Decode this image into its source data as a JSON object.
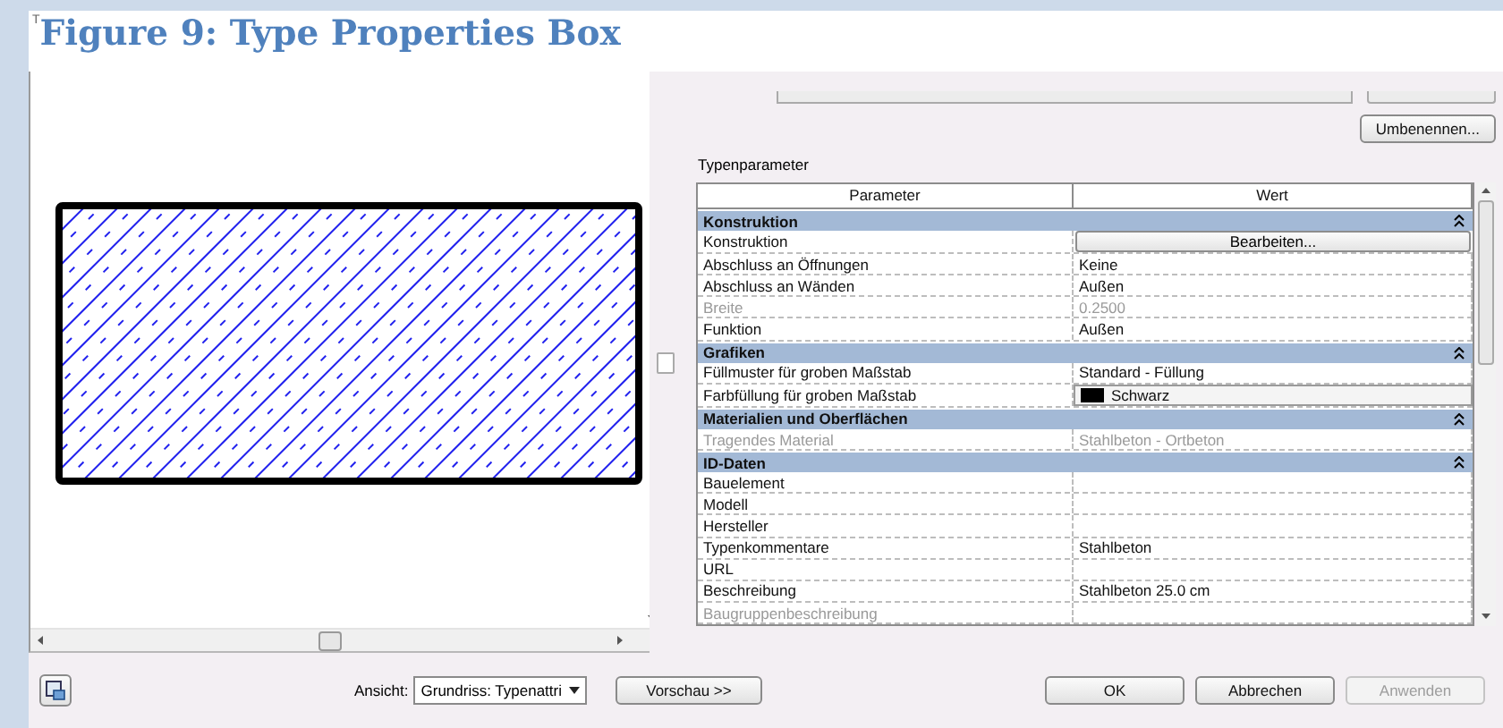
{
  "dialog_title_fragment": "T",
  "title": "Figure 9: Type Properties Box",
  "rename_button": "Umbenennen...",
  "section_label": "Typenparameter",
  "columns": [
    "Parameter",
    "Wert"
  ],
  "groups": [
    {
      "name": "Konstruktion",
      "expanded": true,
      "rows": [
        {
          "parameter": "Konstruktion",
          "value": "Bearbeiten...",
          "kind": "button",
          "disabled": false
        },
        {
          "parameter": "Abschluss an Öffnungen",
          "value": "Keine",
          "kind": "text",
          "disabled": false
        },
        {
          "parameter": "Abschluss an Wänden",
          "value": "Außen",
          "kind": "text",
          "disabled": false
        },
        {
          "parameter": "Breite",
          "value": "0.2500",
          "kind": "text",
          "disabled": true
        },
        {
          "parameter": "Funktion",
          "value": "Außen",
          "kind": "text",
          "disabled": false
        }
      ]
    },
    {
      "name": "Grafiken",
      "expanded": true,
      "rows": [
        {
          "parameter": "Füllmuster für groben Maßstab",
          "value": "Standard - Füllung",
          "kind": "text",
          "disabled": false
        },
        {
          "parameter": "Farbfüllung für groben Maßstab",
          "value": "Schwarz",
          "kind": "color",
          "color": "#000000",
          "disabled": false
        }
      ]
    },
    {
      "name": "Materialien und Oberflächen",
      "expanded": true,
      "rows": [
        {
          "parameter": "Tragendes Material",
          "value": "Stahlbeton - Ortbeton",
          "kind": "text",
          "disabled": true
        }
      ]
    },
    {
      "name": "ID-Daten",
      "expanded": true,
      "rows": [
        {
          "parameter": "Bauelement",
          "kind": "text",
          "disabled": false
        },
        {
          "parameter": "Modell",
          "kind": "text",
          "disabled": false
        },
        {
          "parameter": "Hersteller",
          "kind": "text",
          "disabled": false
        },
        {
          "parameter": "Typenkommentare",
          "value": "Stahlbeton",
          "kind": "text",
          "disabled": false
        },
        {
          "parameter": "URL",
          "kind": "text",
          "disabled": false
        },
        {
          "parameter": "Beschreibung",
          "value": "Stahlbeton 25.0 cm",
          "kind": "text",
          "disabled": false
        },
        {
          "parameter": "Baugruppenbeschreibung",
          "kind": "text",
          "disabled": true
        }
      ]
    }
  ],
  "view": {
    "label": "Ansicht:",
    "value": "Grundriss: Typenattri"
  },
  "preview_button": "Vorschau >>",
  "buttons": [
    {
      "label": "OK",
      "disabled": false
    },
    {
      "label": "Abbrechen",
      "disabled": false
    },
    {
      "label": "Anwenden",
      "disabled": true
    }
  ]
}
